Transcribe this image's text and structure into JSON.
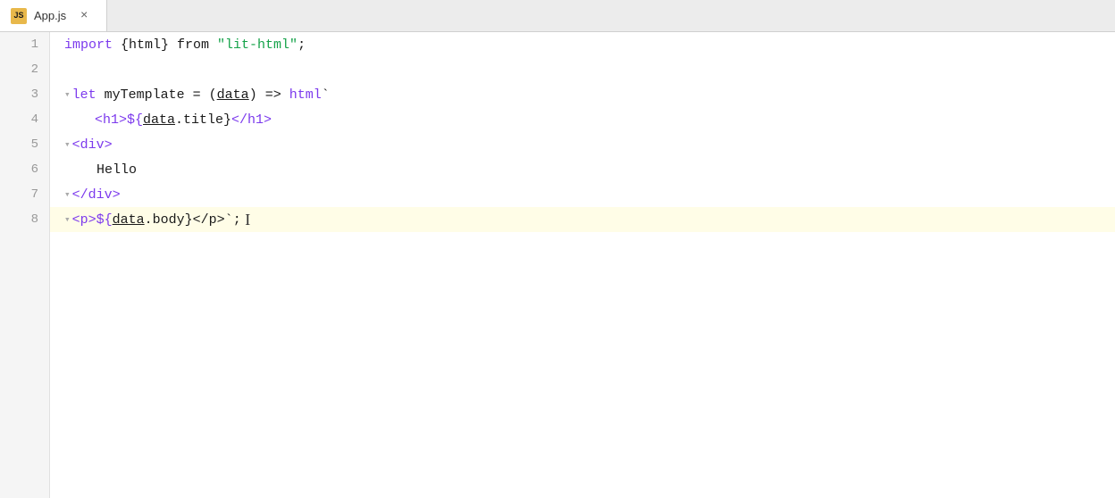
{
  "tab": {
    "icon_label": "JS",
    "filename": "App.js",
    "close_label": "×"
  },
  "lines": [
    {
      "number": "1",
      "highlighted": false,
      "tokens": [
        {
          "text": "import ",
          "class": "kw-purple"
        },
        {
          "text": "{html}",
          "class": "plain"
        },
        {
          "text": " from ",
          "class": "plain"
        },
        {
          "text": "\"lit-html\"",
          "class": "str-green"
        },
        {
          "text": ";",
          "class": "plain"
        }
      ]
    },
    {
      "number": "2",
      "highlighted": false,
      "tokens": []
    },
    {
      "number": "3",
      "highlighted": false,
      "tokens": [
        {
          "text": "▾",
          "class": "fold-arrow"
        },
        {
          "text": "let ",
          "class": "kw-purple"
        },
        {
          "text": "myTemplate",
          "class": "plain"
        },
        {
          "text": " = (",
          "class": "plain"
        },
        {
          "text": "data",
          "class": "plain",
          "underline": true
        },
        {
          "text": ") => ",
          "class": "plain"
        },
        {
          "text": "html",
          "class": "kw-purple"
        },
        {
          "text": "`",
          "class": "plain"
        }
      ]
    },
    {
      "number": "4",
      "highlighted": false,
      "tokens": [
        {
          "text": "  <h1>${",
          "class": "tag-purple"
        },
        {
          "text": "data",
          "class": "plain",
          "underline": true
        },
        {
          "text": ".",
          "class": "plain"
        },
        {
          "text": "title",
          "class": "plain"
        },
        {
          "text": "}</h1>",
          "class": "tag-purple"
        }
      ]
    },
    {
      "number": "5",
      "highlighted": false,
      "tokens": [
        {
          "text": "▾",
          "class": "fold-arrow"
        },
        {
          "text": "<div>",
          "class": "tag-purple"
        }
      ]
    },
    {
      "number": "6",
      "highlighted": false,
      "tokens": [
        {
          "text": "    Hello",
          "class": "plain"
        }
      ]
    },
    {
      "number": "7",
      "highlighted": false,
      "tokens": [
        {
          "text": "▾",
          "class": "fold-arrow"
        },
        {
          "text": "</div>",
          "class": "tag-purple"
        }
      ]
    },
    {
      "number": "8",
      "highlighted": true,
      "tokens": [
        {
          "text": "▾",
          "class": "fold-arrow"
        },
        {
          "text": "<p>${",
          "class": "tag-purple"
        },
        {
          "text": "data",
          "class": "plain",
          "underline": true
        },
        {
          "text": ".",
          "class": "plain"
        },
        {
          "text": "body",
          "class": "plain"
        },
        {
          "text": "}</p>`",
          "class": "tag-purple"
        },
        {
          "text": ";",
          "class": "plain"
        },
        {
          "text": "CURSOR",
          "class": "cursor-marker"
        }
      ]
    }
  ]
}
